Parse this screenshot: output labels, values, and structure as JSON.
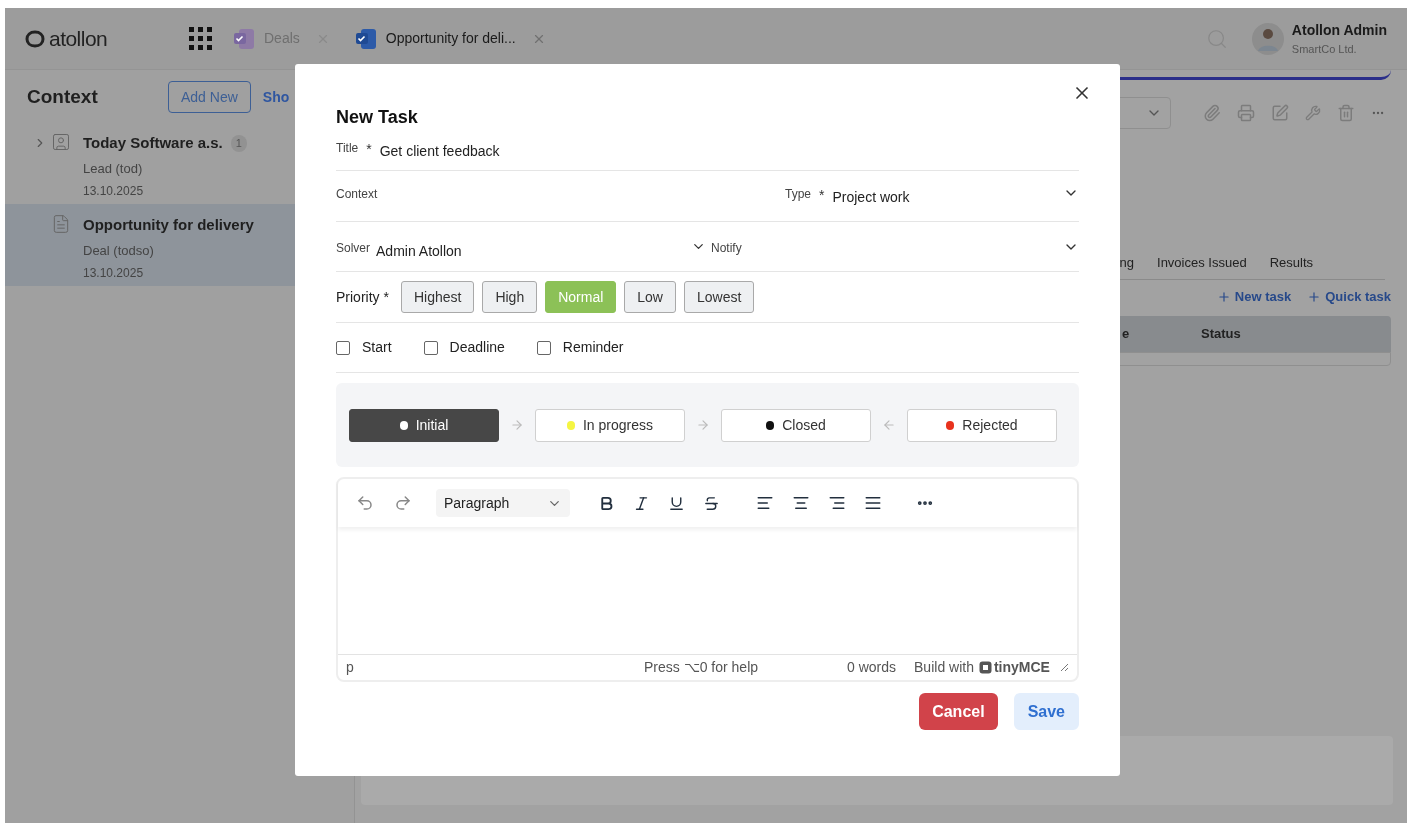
{
  "header": {
    "logo": "atollon",
    "tabs": [
      {
        "label": "Deals",
        "selected": false
      },
      {
        "label": "Opportunity for deli...",
        "selected": true
      }
    ],
    "user": {
      "name": "Atollon Admin",
      "company": "SmartCo Ltd."
    }
  },
  "sidebar": {
    "title": "Context",
    "add_button": "Add New",
    "link": "Sho",
    "items": [
      {
        "kind": "contact",
        "title": "Today Software a.s.",
        "count": "1",
        "subtitle": "Lead (tod)",
        "date": "13.10.2025",
        "selected": false
      },
      {
        "kind": "document",
        "title": "Opportunity for delivery",
        "subtitle": "Deal (todso)",
        "date": "13.10.2025",
        "selected": true
      }
    ]
  },
  "main": {
    "tabs": [
      "ng",
      "Invoices Issued",
      "Results"
    ],
    "actions": [
      "New task",
      "Quick task"
    ],
    "table": {
      "columns": [
        "e",
        "Status"
      ]
    }
  },
  "dialog": {
    "title": "New Task",
    "fields": {
      "title": {
        "label": "Title",
        "required_mark": "*",
        "value": "Get client feedback"
      },
      "context": {
        "label": "Context"
      },
      "type": {
        "label": "Type",
        "required_mark": "*",
        "value": "Project work"
      },
      "solver": {
        "label": "Solver",
        "value": "Admin Atollon"
      },
      "notify": {
        "label": "Notify"
      }
    },
    "priority": {
      "label": "Priority *",
      "options": [
        {
          "label": "Highest",
          "selected": false
        },
        {
          "label": "High",
          "selected": false
        },
        {
          "label": "Normal",
          "selected": true
        },
        {
          "label": "Low",
          "selected": false
        },
        {
          "label": "Lowest",
          "selected": false
        }
      ]
    },
    "dates": [
      {
        "label": "Start",
        "checked": false
      },
      {
        "label": "Deadline",
        "checked": false
      },
      {
        "label": "Reminder",
        "checked": false
      }
    ],
    "states": [
      {
        "label": "Initial",
        "color": "#ffffff",
        "selected": true,
        "kind": "start"
      },
      {
        "label": "In progress",
        "color": "#f5f542",
        "selected": false,
        "kind": "forward"
      },
      {
        "label": "Closed",
        "color": "#111111",
        "selected": false,
        "kind": "forward"
      },
      {
        "label": "Rejected",
        "color": "#e8321e",
        "selected": false,
        "kind": "back"
      }
    ],
    "editor": {
      "block_format": "Paragraph",
      "status_path": "p",
      "help": "Press ⌥0 for help",
      "word_count": "0 words",
      "branding": "Build with",
      "brand": "tinyMCE"
    },
    "buttons": {
      "cancel": "Cancel",
      "save": "Save"
    }
  }
}
